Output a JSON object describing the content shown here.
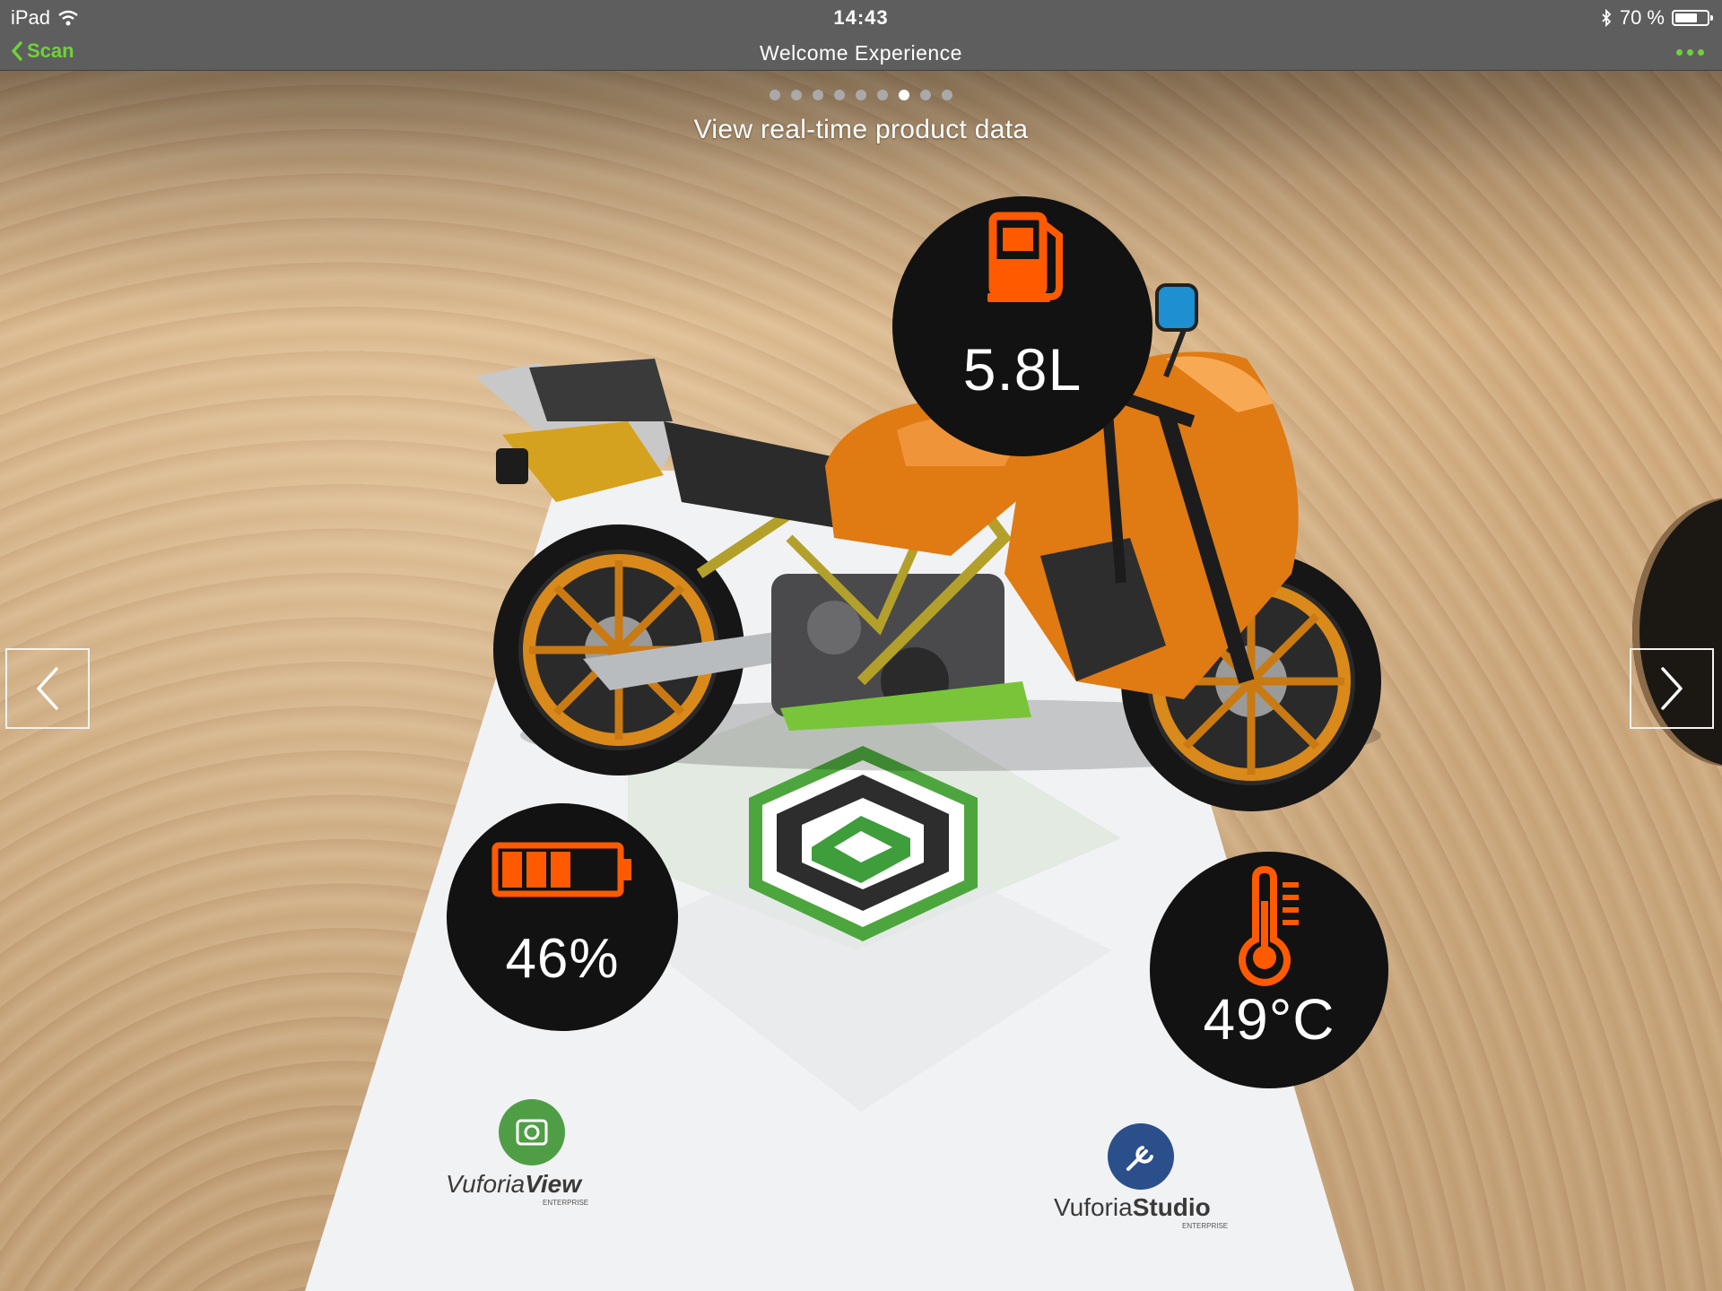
{
  "status_bar": {
    "device": "iPad",
    "time": "14:43",
    "battery_text": "70 %",
    "battery_level": 0.7,
    "icons": [
      "wifi-icon",
      "bluetooth-icon",
      "battery-icon"
    ]
  },
  "nav": {
    "back_label": "Scan",
    "title": "Welcome Experience",
    "more_icon": "ellipsis-icon"
  },
  "carousel": {
    "total": 9,
    "active_index": 6,
    "title": "View real-time product data",
    "prev_icon": "chevron-left-icon",
    "next_icon": "chevron-right-icon"
  },
  "gauges": {
    "fuel": {
      "value": "5.8L",
      "icon": "fuel-pump-icon"
    },
    "battery": {
      "value": "46%",
      "icon": "battery-icon"
    },
    "temperature": {
      "value": "49°C",
      "icon": "thermometer-icon"
    }
  },
  "target_card": {
    "logo_left": {
      "brand": "Vuforia",
      "product": "View",
      "edition": "ENTERPRISE"
    },
    "logo_right": {
      "brand": "Vuforia",
      "product": "Studio",
      "edition": "ENTERPRISE"
    }
  },
  "colors": {
    "accent_green": "#6fd13a",
    "gauge_icon_orange": "#ff5a00",
    "gauge_bg": "#121212",
    "bar_bg": "#5e5e5e"
  }
}
